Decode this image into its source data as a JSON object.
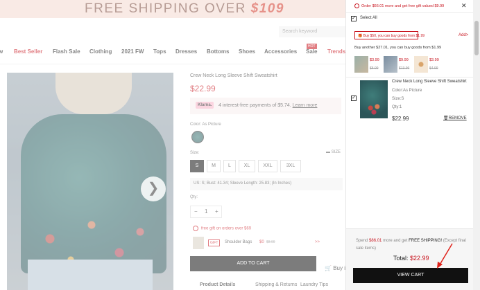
{
  "banner": {
    "text": "FREE SHIPPING OVER",
    "amount": "$109"
  },
  "header": {
    "search_placeholder": "Search keyword",
    "nav": [
      "w",
      "Best Seller",
      "Flash Sale",
      "Clothing",
      "2021 FW",
      "Tops",
      "Dresses",
      "Bottoms",
      "Shoes",
      "Accessories",
      "Sale",
      "Trends"
    ],
    "hot_badge": "HOT"
  },
  "product": {
    "title": "Crew Neck Long Sleeve Shift Sweatshirt",
    "price": "$22.99",
    "klarna_logo": "Klarna.",
    "klarna_text": "4 interest-free payments of $5.74.",
    "klarna_link": "Learn more",
    "color_label": "Color: As Picture",
    "size_label": "Size:",
    "size_guide": "SIZE",
    "sizes": [
      "S",
      "M",
      "L",
      "XL",
      "XXL",
      "3XL"
    ],
    "selected_size": "S",
    "measurements": "US: S;  Bust: 41.34;  Sleeve Length: 25.83;  (In Inches)",
    "qty_label": "Qty:",
    "qty_minus": "−",
    "qty_value": "1",
    "qty_plus": "+",
    "gift_notice": "free gift on orders over $69",
    "gift_tag": "GIFT",
    "gift_name": "Shoulder Bags",
    "gift_price": "$0",
    "gift_old": "$8.99",
    "gift_arrow": ">>",
    "add_to_cart": "ADD TO CART",
    "buy_it": "Buy it",
    "tabs": [
      "Product Details",
      "Shipping & Returns",
      "Laundry Tips"
    ],
    "next_arrow": "❯"
  },
  "drawer": {
    "top_notice": "Order $66.01 more and get free gift valued $9.99",
    "close": "✕",
    "select_all": "Select All",
    "promo": "Buy $50, you can buy goods from $1.99",
    "add_link": "Add>",
    "sub_notice": "Buy another $27.01, you can buy goods from $1.99",
    "upsells": [
      {
        "price": "$3.99",
        "old": "$5.99"
      },
      {
        "price": "$9.99",
        "old": "$13.99"
      },
      {
        "price": "$3.99",
        "old": "$4.99"
      }
    ],
    "item": {
      "title": "Crew Neck Long Sleeve Shift Sweatshirt",
      "color": "Color:As Picture",
      "size": "Size:S",
      "qty": "Qty:1",
      "price": "$22.99",
      "remove": "REMOVE"
    },
    "ship_pre": "Spend",
    "ship_amt": "$86.01",
    "ship_mid": "more and get",
    "ship_free": "FREE SHIPPING!",
    "ship_post": "(Except final sale items)",
    "total_label": "Total:",
    "total_value": "$22.99",
    "view_cart": "VIEW CART"
  },
  "colors": {
    "accent": "#c8141e",
    "dark": "#111111",
    "banner_bg": "#f4d9d0"
  }
}
